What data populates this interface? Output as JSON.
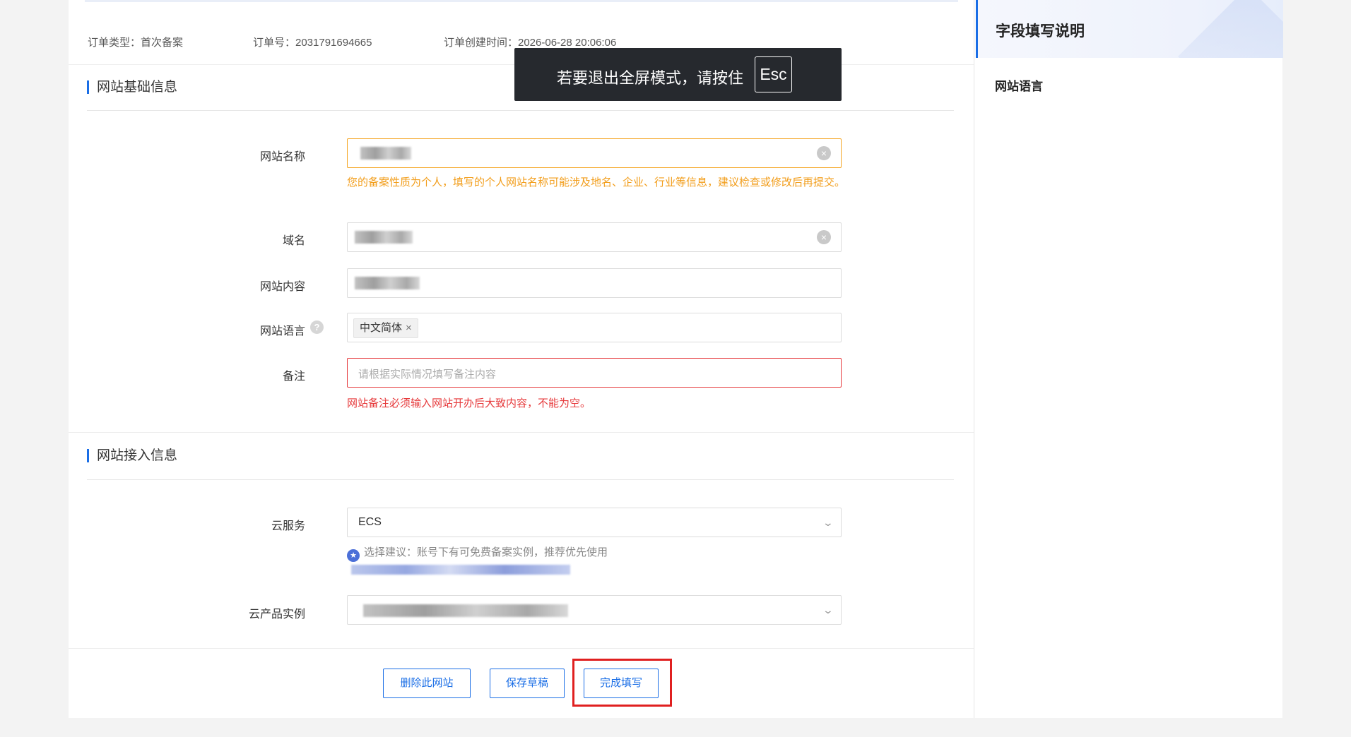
{
  "order": {
    "type_label": "订单类型：首次备案",
    "number_label": "订单号：2031791694665",
    "created_label": "订单创建时间：2026-06-28 20:06:06"
  },
  "fullscreen_toast": {
    "message": "若要退出全屏模式，请按住",
    "key": "Esc"
  },
  "section_basic": {
    "title": "网站基础信息",
    "site_name": {
      "label": "网站名称",
      "warning": "您的备案性质为个人，填写的个人网站名称可能涉及地名、企业、行业等信息，建议检查或修改后再提交。"
    },
    "domain": {
      "label": "域名"
    },
    "content": {
      "label": "网站内容"
    },
    "language": {
      "label": "网站语言",
      "tag": "中文简体",
      "tag_remove": "×"
    },
    "remark": {
      "label": "备注",
      "placeholder": "请根据实际情况填写备注内容",
      "error": "网站备注必须输入网站开办后大致内容，不能为空。"
    }
  },
  "section_access": {
    "title": "网站接入信息",
    "cloud_service": {
      "label": "云服务",
      "value": "ECS",
      "tip": "选择建议：账号下有可免费备案实例，推荐优先使用"
    },
    "cloud_instance": {
      "label": "云产品实例"
    }
  },
  "actions": {
    "delete_label": "删除此网站",
    "save_draft_label": "保存草稿",
    "complete_label": "完成填写"
  },
  "side_panel": {
    "title": "字段填写说明",
    "item": "网站语言"
  },
  "colors": {
    "accent": "#1a6ee6",
    "warning": "#f29d1a",
    "error": "#e6393b",
    "highlight_box": "#e02020"
  }
}
